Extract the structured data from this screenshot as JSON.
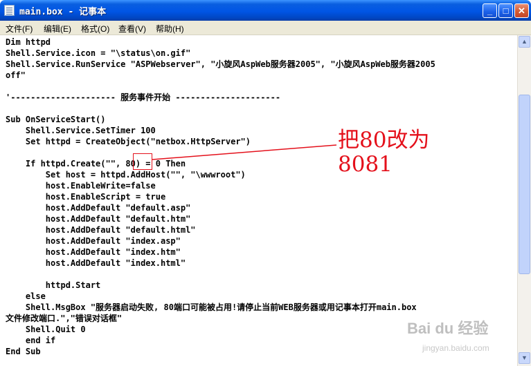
{
  "window": {
    "title": "main.box - 记事本",
    "minimize_glyph": "_",
    "maximize_glyph": "□",
    "close_glyph": "✕"
  },
  "menu": [
    {
      "label": "文件(F)"
    },
    {
      "label": "编辑(E)"
    },
    {
      "label": "格式(O)"
    },
    {
      "label": "查看(V)"
    },
    {
      "label": "帮助(H)"
    }
  ],
  "editor": {
    "lines": [
      "Dim httpd",
      "Shell.Service.icon = \"\\status\\on.gif\"",
      "Shell.Service.RunService \"ASPWebserver\", \"小旋风AspWeb服务器2005\", \"小旋风AspWeb服务器2005",
      "off\"",
      "",
      "'--------------------- 服务事件开始 ---------------------",
      "",
      "Sub OnServiceStart()",
      "    Shell.Service.SetTimer 100",
      "    Set httpd = CreateObject(\"netbox.HttpServer\")",
      "",
      "    If httpd.Create(\"\", 80) = 0 Then",
      "        Set host = httpd.AddHost(\"\", \"\\wwwroot\")",
      "        host.EnableWrite=false",
      "        host.EnableScript = true",
      "        host.AddDefault \"default.asp\"",
      "        host.AddDefault \"default.htm\"",
      "        host.AddDefault \"default.html\"",
      "        host.AddDefault \"index.asp\"",
      "        host.AddDefault \"index.htm\"",
      "        host.AddDefault \"index.html\"",
      "",
      "        httpd.Start",
      "    else",
      "    Shell.MsgBox \"服务器启动失败, 80端口可能被占用!请停止当前WEB服务器或用记事本打开main.box",
      "文件修改端口.\",\"错误对话框\"",
      "    Shell.Quit 0",
      "    end if",
      "End Sub"
    ]
  },
  "annotation": {
    "text": "把80改为\n8081",
    "color": "#e4101b"
  },
  "watermark": {
    "brand": "Bai du 经验",
    "url": "jingyan.baidu.com"
  },
  "scrollbar": {
    "up_glyph": "▲",
    "down_glyph": "▼"
  }
}
